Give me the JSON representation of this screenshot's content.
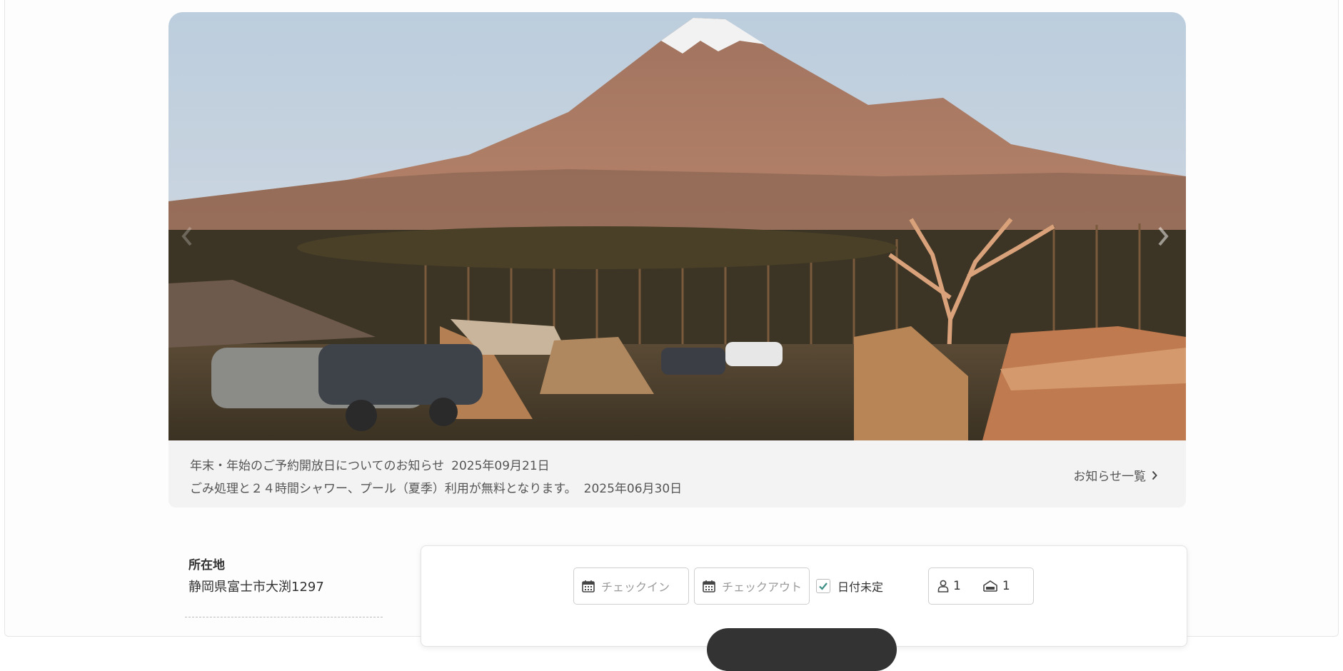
{
  "hero": {
    "image": "mount-fuji-campsite-photo",
    "prev_icon": "chevron-left-icon",
    "next_icon": "chevron-right-icon"
  },
  "news": {
    "items": [
      {
        "title": "年末・年始のご予約開放日についてのお知らせ",
        "date": "2025年09月21日"
      },
      {
        "title": "ごみ処理と２４時間シャワー、プール（夏季）利用が無料となります。",
        "date": "2025年06月30日"
      }
    ],
    "list_link": "お知らせ一覧"
  },
  "location": {
    "label": "所在地",
    "address": "静岡県富士市大渕1297"
  },
  "search": {
    "checkin_placeholder": "チェックイン",
    "checkout_placeholder": "チェックアウト",
    "date_undecided_label": "日付未定",
    "date_undecided_checked": true,
    "guests": "1",
    "rooms": "1"
  },
  "colors": {
    "news_bg": "#f3f3f3",
    "check_accent": "#3d8f85",
    "button_dark": "#333333"
  }
}
